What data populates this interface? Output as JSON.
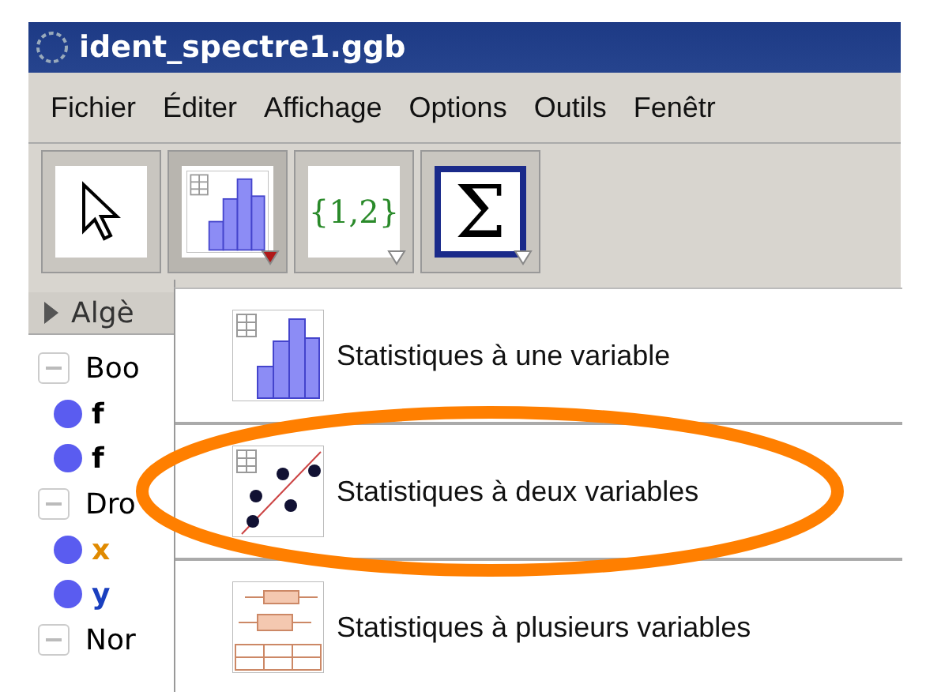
{
  "window": {
    "title": "ident_spectre1.ggb"
  },
  "menu_bar": [
    "Fichier",
    "Éditer",
    "Affichage",
    "Options",
    "Outils",
    "Fenêtr"
  ],
  "toolbar": [
    {
      "kind": "pointer",
      "selected": false
    },
    {
      "kind": "histogram",
      "selected": false,
      "expanded": true
    },
    {
      "kind": "list",
      "label": "{1,2}",
      "selected": false,
      "expanded": false
    },
    {
      "kind": "sum",
      "label": "Σ",
      "selected": true,
      "expanded": false
    }
  ],
  "algebra": {
    "title": "Algè",
    "groups": [
      {
        "label": "Boo",
        "expanded": true,
        "children": [
          {
            "label": "f",
            "color": "#000000"
          },
          {
            "label": "f",
            "color": "#000000"
          }
        ]
      },
      {
        "label": "Dro",
        "expanded": true,
        "children": [
          {
            "label": "x",
            "color": "#e08a00"
          },
          {
            "label": "y",
            "color": "#1a3fbf"
          }
        ]
      },
      {
        "label": "Nor",
        "expanded": true
      }
    ]
  },
  "dropdown": {
    "items": [
      {
        "kind": "one-variable",
        "label": "Statistiques à une variable",
        "highlighted": false
      },
      {
        "kind": "two-variable",
        "label": "Statistiques à deux variables",
        "highlighted": true
      },
      {
        "kind": "multi-variable",
        "label": "Statistiques à plusieurs variables",
        "highlighted": false
      }
    ]
  }
}
